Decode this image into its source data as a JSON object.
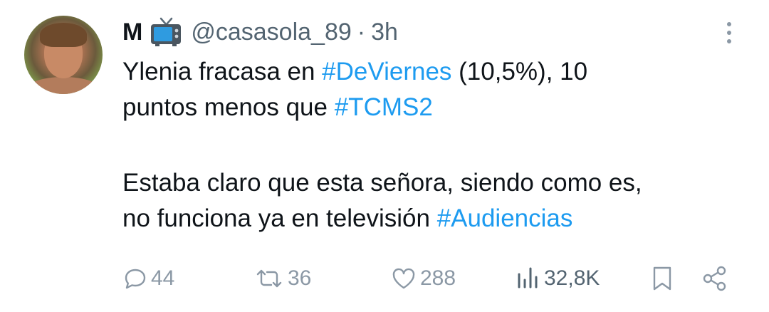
{
  "tweet": {
    "author_name": "M",
    "author_emoji": "tv-icon",
    "handle": "@casasola_89",
    "separator": "·",
    "time": "3h",
    "text_lines": [
      [
        {
          "t": "Ylenia fracasa en ",
          "tag": false
        },
        {
          "t": "#DeViernes",
          "tag": true
        },
        {
          "t": " (10,5%), 10",
          "tag": false
        }
      ],
      [
        {
          "t": "puntos menos que ",
          "tag": false
        },
        {
          "t": "#TCMS2",
          "tag": true
        }
      ],
      [],
      [
        {
          "t": "Estaba claro que esta señora, siendo como es,",
          "tag": false
        }
      ],
      [
        {
          "t": "no funciona ya en televisión ",
          "tag": false
        },
        {
          "t": "#Audiencias",
          "tag": true
        }
      ]
    ]
  },
  "actions": {
    "replies": "44",
    "retweets": "36",
    "likes": "288",
    "views": "32,8K"
  },
  "colors": {
    "hashtag": "#1d9bf0",
    "muted": "#536471",
    "action_icon": "#8b98a5",
    "text": "#0f1419"
  },
  "icons": {
    "reply": "speech-bubble-icon",
    "retweet": "retweet-arrows-icon",
    "like": "heart-icon",
    "views": "bar-chart-icon",
    "bookmark": "bookmark-icon",
    "share": "share-icon",
    "more": "more-vertical-icon"
  }
}
